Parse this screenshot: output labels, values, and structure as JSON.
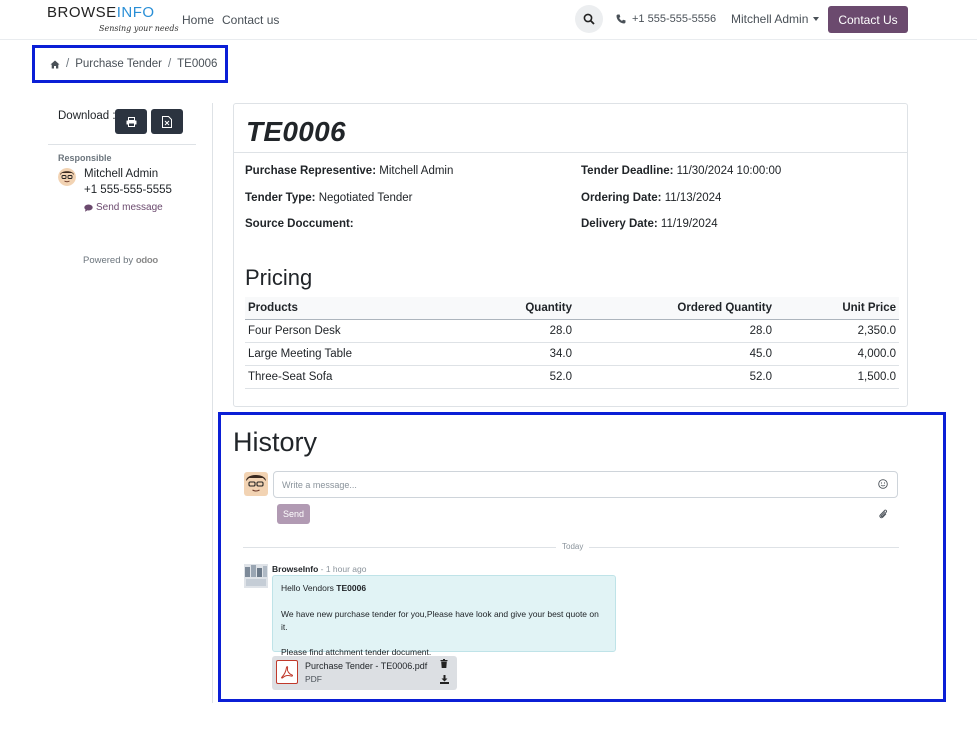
{
  "header": {
    "logo_browse": "BROWSE",
    "logo_info": "INFO",
    "logo_tagline": "Sensing your needs",
    "nav": [
      "Home",
      "Contact us"
    ],
    "phone": "+1 555-555-5556",
    "user": "Mitchell Admin",
    "contact_button": "Contact Us",
    "icons": {
      "search": "search-icon",
      "phone": "phone-icon",
      "user_caret": "chevron-down-icon"
    },
    "colors": {
      "brand": "#6b4a6e",
      "logo_accent": "#2a8fd6"
    }
  },
  "breadcrumb": {
    "home_icon": "home-icon",
    "items": [
      "Purchase Tender",
      "TE0006"
    ],
    "separator": "/"
  },
  "sidebar": {
    "download_label": "Download :",
    "download_buttons": [
      "print-icon",
      "excel-file-icon"
    ],
    "responsible_label": "Responsible",
    "responsible_name": "Mitchell Admin",
    "responsible_phone": "+1 555-555-5555",
    "send_message": "Send message",
    "powered_by": "Powered by",
    "powered_brand": "odoo"
  },
  "tender": {
    "title": "TE0006",
    "fields": {
      "purchase_rep_label": "Purchase Representive:",
      "purchase_rep_value": "Mitchell Admin",
      "tender_type_label": "Tender Type:",
      "tender_type_value": "Negotiated Tender",
      "source_doc_label": "Source Doccument:",
      "source_doc_value": "",
      "deadline_label": "Tender Deadline:",
      "deadline_value": "11/30/2024 10:00:00",
      "ordering_label": "Ordering Date:",
      "ordering_value": "11/13/2024",
      "delivery_label": "Delivery Date:",
      "delivery_value": "11/19/2024"
    },
    "pricing_title": "Pricing",
    "columns": [
      "Products",
      "Quantity",
      "Ordered Quantity",
      "Unit Price"
    ],
    "rows": [
      [
        "Four Person Desk",
        "28.0",
        "28.0",
        "2,350.0"
      ],
      [
        "Large Meeting Table",
        "34.0",
        "45.0",
        "4,000.0"
      ],
      [
        "Three-Seat Sofa",
        "52.0",
        "52.0",
        "1,500.0"
      ]
    ]
  },
  "history": {
    "title": "History",
    "placeholder": "Write a message...",
    "send_label": "Send",
    "today_label": "Today",
    "message": {
      "author": "BrowseInfo",
      "time": "- 1 hour ago",
      "greeting_prefix": "Hello Vendors ",
      "greeting_bold": "TE0006",
      "line2": "We have new purchase tender for you,Please have look and give your best quote on it.",
      "line3": "Please find attchment tender document."
    },
    "attachment": {
      "name": "Purchase Tender - TE0006.pdf",
      "type": "PDF"
    }
  }
}
